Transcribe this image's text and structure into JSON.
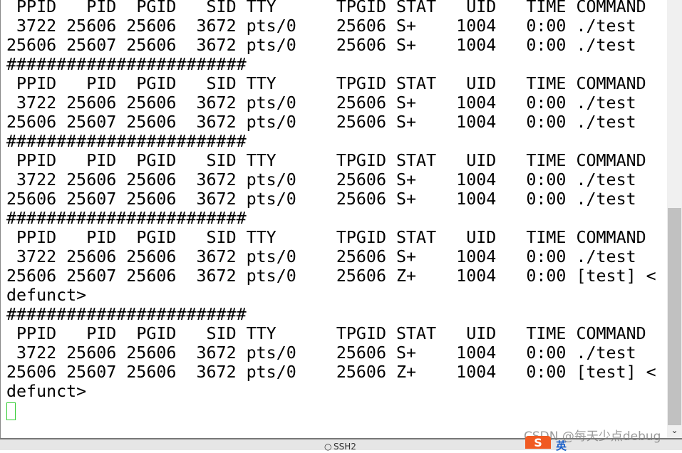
{
  "terminal": {
    "lines": [
      " PPID   PID  PGID   SID TTY      TPGID STAT   UID   TIME COMMAND",
      " 3722 25606 25606  3672 pts/0    25606 S+    1004   0:00 ./test",
      "25606 25607 25606  3672 pts/0    25606 S+    1004   0:00 ./test",
      "########################",
      " PPID   PID  PGID   SID TTY      TPGID STAT   UID   TIME COMMAND",
      " 3722 25606 25606  3672 pts/0    25606 S+    1004   0:00 ./test",
      "25606 25607 25606  3672 pts/0    25606 S+    1004   0:00 ./test",
      "########################",
      " PPID   PID  PGID   SID TTY      TPGID STAT   UID   TIME COMMAND",
      " 3722 25606 25606  3672 pts/0    25606 S+    1004   0:00 ./test",
      "25606 25607 25606  3672 pts/0    25606 S+    1004   0:00 ./test",
      "########################",
      " PPID   PID  PGID   SID TTY      TPGID STAT   UID   TIME COMMAND",
      " 3722 25606 25606  3672 pts/0    25606 S+    1004   0:00 ./test",
      "25606 25607 25606  3672 pts/0    25606 Z+    1004   0:00 [test] <",
      "defunct>",
      "########################",
      " PPID   PID  PGID   SID TTY      TPGID STAT   UID   TIME COMMAND",
      " 3722 25606 25606  3672 pts/0    25606 S+    1004   0:00 ./test",
      "25606 25607 25606  3672 pts/0    25606 Z+    1004   0:00 [test] <",
      "defunct>"
    ],
    "cursor_color": "#33cc33"
  },
  "status_bar": {
    "protocol": "SSH2"
  },
  "watermark": "CSDN @每天少点debug",
  "ime": {
    "logo": "S",
    "mode": "英"
  }
}
